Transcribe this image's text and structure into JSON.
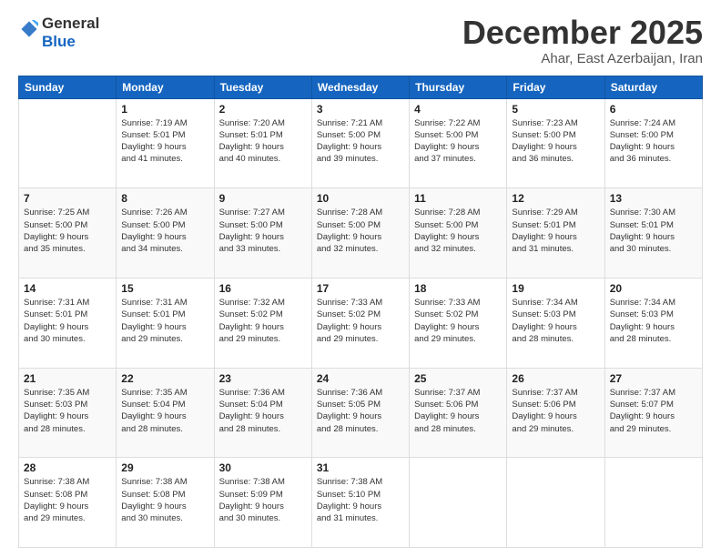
{
  "header": {
    "logo_line1": "General",
    "logo_line2": "Blue",
    "title": "December 2025",
    "subtitle": "Ahar, East Azerbaijan, Iran"
  },
  "weekdays": [
    "Sunday",
    "Monday",
    "Tuesday",
    "Wednesday",
    "Thursday",
    "Friday",
    "Saturday"
  ],
  "weeks": [
    [
      {
        "day": "",
        "detail": ""
      },
      {
        "day": "1",
        "detail": "Sunrise: 7:19 AM\nSunset: 5:01 PM\nDaylight: 9 hours\nand 41 minutes."
      },
      {
        "day": "2",
        "detail": "Sunrise: 7:20 AM\nSunset: 5:01 PM\nDaylight: 9 hours\nand 40 minutes."
      },
      {
        "day": "3",
        "detail": "Sunrise: 7:21 AM\nSunset: 5:00 PM\nDaylight: 9 hours\nand 39 minutes."
      },
      {
        "day": "4",
        "detail": "Sunrise: 7:22 AM\nSunset: 5:00 PM\nDaylight: 9 hours\nand 37 minutes."
      },
      {
        "day": "5",
        "detail": "Sunrise: 7:23 AM\nSunset: 5:00 PM\nDaylight: 9 hours\nand 36 minutes."
      },
      {
        "day": "6",
        "detail": "Sunrise: 7:24 AM\nSunset: 5:00 PM\nDaylight: 9 hours\nand 36 minutes."
      }
    ],
    [
      {
        "day": "7",
        "detail": "Sunrise: 7:25 AM\nSunset: 5:00 PM\nDaylight: 9 hours\nand 35 minutes."
      },
      {
        "day": "8",
        "detail": "Sunrise: 7:26 AM\nSunset: 5:00 PM\nDaylight: 9 hours\nand 34 minutes."
      },
      {
        "day": "9",
        "detail": "Sunrise: 7:27 AM\nSunset: 5:00 PM\nDaylight: 9 hours\nand 33 minutes."
      },
      {
        "day": "10",
        "detail": "Sunrise: 7:28 AM\nSunset: 5:00 PM\nDaylight: 9 hours\nand 32 minutes."
      },
      {
        "day": "11",
        "detail": "Sunrise: 7:28 AM\nSunset: 5:00 PM\nDaylight: 9 hours\nand 32 minutes."
      },
      {
        "day": "12",
        "detail": "Sunrise: 7:29 AM\nSunset: 5:01 PM\nDaylight: 9 hours\nand 31 minutes."
      },
      {
        "day": "13",
        "detail": "Sunrise: 7:30 AM\nSunset: 5:01 PM\nDaylight: 9 hours\nand 30 minutes."
      }
    ],
    [
      {
        "day": "14",
        "detail": "Sunrise: 7:31 AM\nSunset: 5:01 PM\nDaylight: 9 hours\nand 30 minutes."
      },
      {
        "day": "15",
        "detail": "Sunrise: 7:31 AM\nSunset: 5:01 PM\nDaylight: 9 hours\nand 29 minutes."
      },
      {
        "day": "16",
        "detail": "Sunrise: 7:32 AM\nSunset: 5:02 PM\nDaylight: 9 hours\nand 29 minutes."
      },
      {
        "day": "17",
        "detail": "Sunrise: 7:33 AM\nSunset: 5:02 PM\nDaylight: 9 hours\nand 29 minutes."
      },
      {
        "day": "18",
        "detail": "Sunrise: 7:33 AM\nSunset: 5:02 PM\nDaylight: 9 hours\nand 29 minutes."
      },
      {
        "day": "19",
        "detail": "Sunrise: 7:34 AM\nSunset: 5:03 PM\nDaylight: 9 hours\nand 28 minutes."
      },
      {
        "day": "20",
        "detail": "Sunrise: 7:34 AM\nSunset: 5:03 PM\nDaylight: 9 hours\nand 28 minutes."
      }
    ],
    [
      {
        "day": "21",
        "detail": "Sunrise: 7:35 AM\nSunset: 5:03 PM\nDaylight: 9 hours\nand 28 minutes."
      },
      {
        "day": "22",
        "detail": "Sunrise: 7:35 AM\nSunset: 5:04 PM\nDaylight: 9 hours\nand 28 minutes."
      },
      {
        "day": "23",
        "detail": "Sunrise: 7:36 AM\nSunset: 5:04 PM\nDaylight: 9 hours\nand 28 minutes."
      },
      {
        "day": "24",
        "detail": "Sunrise: 7:36 AM\nSunset: 5:05 PM\nDaylight: 9 hours\nand 28 minutes."
      },
      {
        "day": "25",
        "detail": "Sunrise: 7:37 AM\nSunset: 5:06 PM\nDaylight: 9 hours\nand 28 minutes."
      },
      {
        "day": "26",
        "detail": "Sunrise: 7:37 AM\nSunset: 5:06 PM\nDaylight: 9 hours\nand 29 minutes."
      },
      {
        "day": "27",
        "detail": "Sunrise: 7:37 AM\nSunset: 5:07 PM\nDaylight: 9 hours\nand 29 minutes."
      }
    ],
    [
      {
        "day": "28",
        "detail": "Sunrise: 7:38 AM\nSunset: 5:08 PM\nDaylight: 9 hours\nand 29 minutes."
      },
      {
        "day": "29",
        "detail": "Sunrise: 7:38 AM\nSunset: 5:08 PM\nDaylight: 9 hours\nand 30 minutes."
      },
      {
        "day": "30",
        "detail": "Sunrise: 7:38 AM\nSunset: 5:09 PM\nDaylight: 9 hours\nand 30 minutes."
      },
      {
        "day": "31",
        "detail": "Sunrise: 7:38 AM\nSunset: 5:10 PM\nDaylight: 9 hours\nand 31 minutes."
      },
      {
        "day": "",
        "detail": ""
      },
      {
        "day": "",
        "detail": ""
      },
      {
        "day": "",
        "detail": ""
      }
    ]
  ]
}
